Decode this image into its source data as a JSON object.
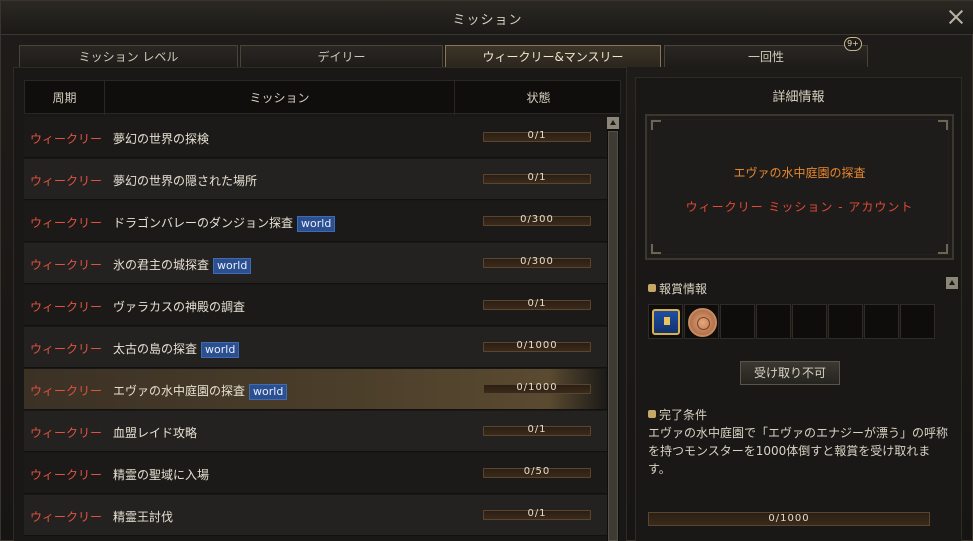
{
  "window": {
    "title": "ミッション"
  },
  "tabs": [
    {
      "label": "ミッション レベル"
    },
    {
      "label": "デイリー"
    },
    {
      "label": "ウィークリー&マンスリー"
    },
    {
      "label": "一回性"
    }
  ],
  "badge": "9+",
  "table": {
    "headers": [
      "周期",
      "ミッション",
      "状態"
    ],
    "rows": [
      {
        "cycle": "ウィークリー",
        "name": "夢幻の世界の探検",
        "world": "",
        "progress": "0/1"
      },
      {
        "cycle": "ウィークリー",
        "name": "夢幻の世界の隠された場所",
        "world": "",
        "progress": "0/1"
      },
      {
        "cycle": "ウィークリー",
        "name": "ドラゴンバレーのダンジョン探査",
        "world": "world",
        "progress": "0/300"
      },
      {
        "cycle": "ウィークリー",
        "name": "氷の君主の城探査",
        "world": "world",
        "progress": "0/300"
      },
      {
        "cycle": "ウィークリー",
        "name": "ヴァラカスの神殿の調査",
        "world": "",
        "progress": "0/1"
      },
      {
        "cycle": "ウィークリー",
        "name": "太古の島の探査",
        "world": "world",
        "progress": "0/1000"
      },
      {
        "cycle": "ウィークリー",
        "name": "エヴァの水中庭園の探査",
        "world": "world",
        "progress": "0/1000"
      },
      {
        "cycle": "ウィークリー",
        "name": "血盟レイド攻略",
        "world": "",
        "progress": "0/1"
      },
      {
        "cycle": "ウィークリー",
        "name": "精霊の聖域に入場",
        "world": "",
        "progress": "0/50"
      },
      {
        "cycle": "ウィークリー",
        "name": "精霊王討伐",
        "world": "",
        "progress": "0/1"
      }
    ]
  },
  "detail": {
    "title": "詳細情報",
    "mission_name": "エヴァの水中庭園の探査",
    "mission_type": "ウィークリー ミッション  -  アカウント",
    "reward_label": "報賞情報",
    "claim_button": "受け取り不可",
    "condition_label": "完了条件",
    "condition_text": "エヴァの水中庭園で「エヴァのエナジーが漂う」の呼称を持つモンスターを1000体倒すと報賞を受け取れます。",
    "progress": "0/1000"
  },
  "colors": {
    "cycle_red": "#e2533f",
    "detail_orange": "#e6872e",
    "world_badge": "#2b4f8f"
  }
}
